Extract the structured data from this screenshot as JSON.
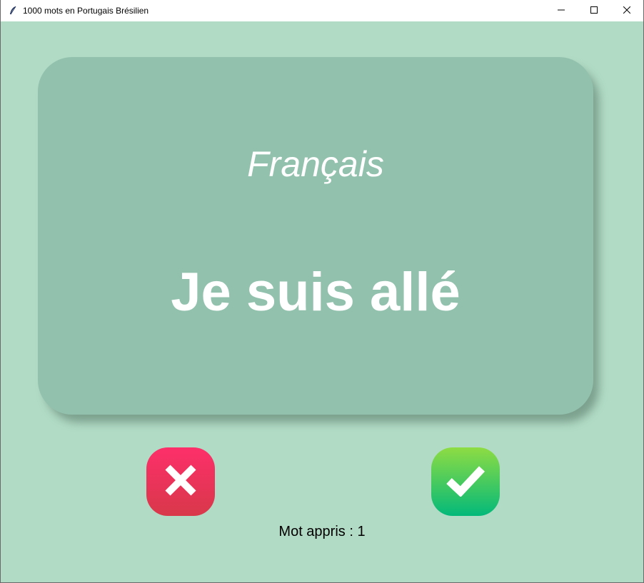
{
  "window": {
    "title": "1000 mots en Portugais Brésilien",
    "icon": "feather-icon",
    "controls": [
      "minimize-icon",
      "maximize-icon",
      "close-icon"
    ]
  },
  "card": {
    "language": "Français",
    "word": "Je suis allé"
  },
  "buttons": {
    "wrong_icon": "cross-icon",
    "right_icon": "checkmark-icon"
  },
  "status": {
    "score_text": "Mot appris : 1"
  },
  "colors": {
    "background": "#b1dbc5",
    "card": "#92c1ae",
    "wrong_button": "#f02e5d",
    "right_button": "#45c85e"
  }
}
